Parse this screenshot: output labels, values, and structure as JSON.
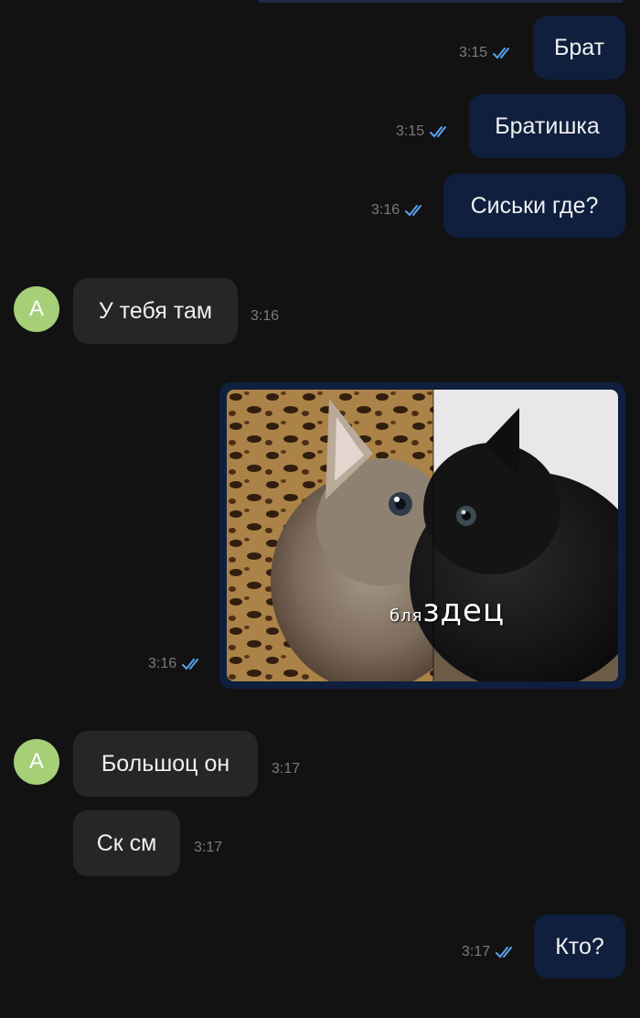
{
  "messages": [
    {
      "text": "Брат",
      "time": "3:15"
    },
    {
      "text": "Братишка",
      "time": "3:15"
    },
    {
      "text": "Сиськи где?",
      "time": "3:16"
    },
    {
      "text": "У тебя там",
      "time": "3:16",
      "avatar": "А"
    },
    {
      "time": "3:16",
      "image": {
        "caption_small": "бля",
        "caption_big": "здец"
      }
    },
    {
      "text": "Большоц он",
      "time": "3:17",
      "avatar": "А"
    },
    {
      "text": "Ск см",
      "time": "3:17"
    },
    {
      "text": "Кто?",
      "time": "3:17"
    }
  ],
  "icons": {
    "read_receipt": "double-check-icon"
  },
  "colors": {
    "background": "#121213",
    "outgoing_bubble": "#0f1f3d",
    "incoming_bubble": "#262628",
    "check": "#5aa2f0",
    "avatar": "#a6cf78"
  }
}
